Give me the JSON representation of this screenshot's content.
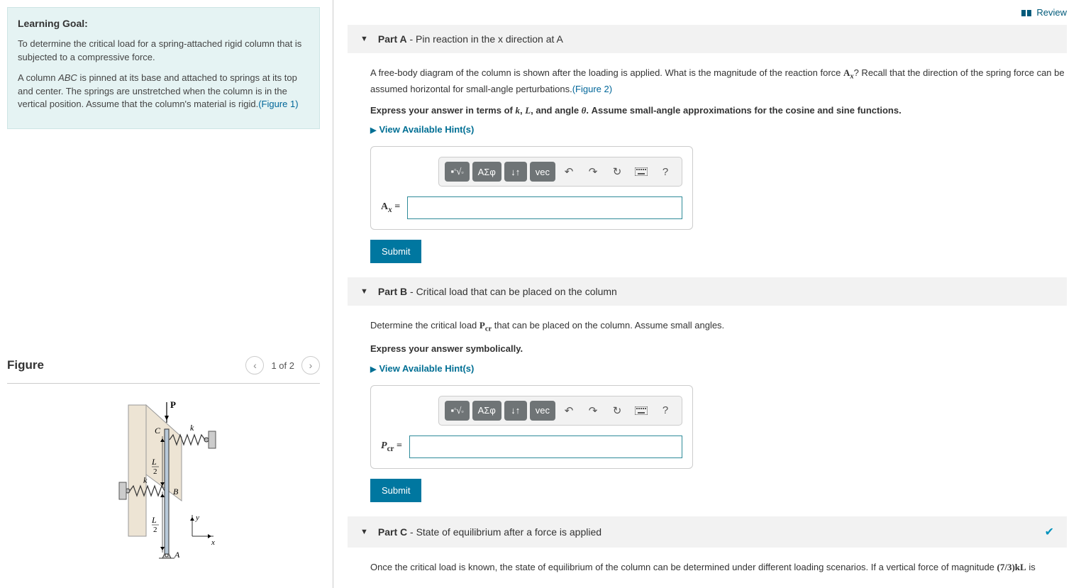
{
  "review_link": "Review",
  "learning_goal": {
    "heading": "Learning Goal:",
    "para1_a": "To determine the critical load for a spring-attached rigid column that is subjected to a compressive force.",
    "para2_a": "A column ",
    "para2_abc": "ABC",
    "para2_b": " is pinned at its base and attached to springs at its top and center. The springs are unstretched when the column is in the vertical position. Assume that the column's material is rigid.",
    "para2_fig": "(Figure 1)"
  },
  "figure": {
    "heading": "Figure",
    "counter": "1 of 2"
  },
  "partA": {
    "label": "Part A",
    "title_rest": " - Pin reaction in the x direction at A",
    "desc1_a": "A free-body diagram of the column is shown after the loading is applied. What is the magnitude of the reaction force ",
    "desc1_ax": "A",
    "desc1_axsub": "x",
    "desc1_b": "? Recall that the direction of the spring force can be assumed horizontal for small-angle perturbations.",
    "desc1_fig": "(Figure 2)",
    "instruction_a": "Express your answer in terms of ",
    "instruction_k": "k",
    "instruction_c1": ", ",
    "instruction_L": "L",
    "instruction_c2": ", and angle ",
    "instruction_th": "θ",
    "instruction_b": ". Assume small-angle approximations for the cosine and sine functions.",
    "hints": "View Available Hint(s)",
    "answer_label_a": "A",
    "answer_label_sub": "x",
    "answer_label_eq": " =",
    "submit": "Submit"
  },
  "partB": {
    "label": "Part B",
    "title_rest": " - Critical load that can be placed on the column",
    "desc1_a": "Determine the critical load ",
    "desc1_pcr_p": "P",
    "desc1_pcr_sub": "cr",
    "desc1_b": " that can be placed on the column. Assume small angles.",
    "instruction": "Express your answer symbolically.",
    "hints": "View Available Hint(s)",
    "answer_label_p": "P",
    "answer_label_sub": "cr",
    "answer_label_eq": " =",
    "submit": "Submit"
  },
  "partC": {
    "label": "Part C",
    "title_rest": " - State of equilibrium after a force is applied",
    "desc1_a": "Once the critical load is known, the state of equilibrium of the column can be determined under different loading scenarios. If a vertical force of magnitude ",
    "desc1_frac": "(7/3)kL",
    "desc1_b": " is"
  },
  "toolbar": {
    "templates": "■√☐",
    "greek": "ΑΣφ",
    "arrows": "↓↑",
    "vec": "vec",
    "undo": "undo",
    "redo": "redo",
    "reset": "reset",
    "keyboard": "keyboard",
    "help": "?"
  }
}
